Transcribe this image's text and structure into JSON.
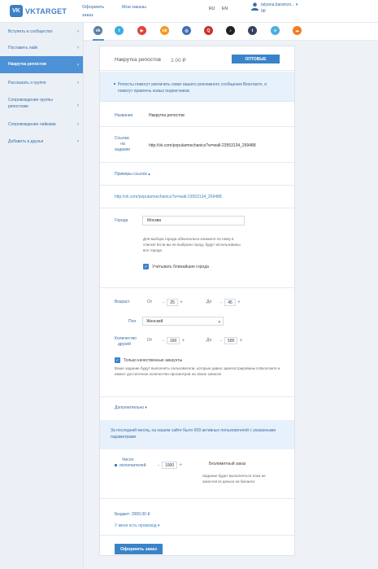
{
  "header": {
    "logo_badge": "VK",
    "logo_text": "VKTARGET",
    "nav": {
      "order_line1": "Оформить",
      "order_line2": "заказ",
      "my_orders": "Мои заказы"
    },
    "lang": {
      "ru": "RU",
      "en": "EN"
    },
    "user": {
      "name": "tatyana.baramzo...",
      "balance": "0₽"
    }
  },
  "sidebar": {
    "items": [
      {
        "label": "Вступить в сообщество"
      },
      {
        "label": "Поставить лайк"
      },
      {
        "label": "Накрутка репостов"
      },
      {
        "label": "Рассказать о группе"
      },
      {
        "label": "Сопровождение группы репостами"
      },
      {
        "label": "Сопровождение лайками"
      },
      {
        "label": "Добавить в друзья"
      }
    ]
  },
  "tabs": [
    {
      "icon": "vk-icon",
      "glyph": "vk",
      "color": "#5b7fa6"
    },
    {
      "icon": "twitter-icon",
      "glyph": "t",
      "color": "#3ab0e2"
    },
    {
      "icon": "youtube-icon",
      "glyph": "▶",
      "color": "#e0443a"
    },
    {
      "icon": "odnoklassniki-icon",
      "glyph": "ok",
      "color": "#f29a23"
    },
    {
      "icon": "instagram-icon",
      "glyph": "◎",
      "color": "#3d6fb4"
    },
    {
      "icon": "quora-icon",
      "glyph": "Q",
      "color": "#c8342e"
    },
    {
      "icon": "tiktok-icon",
      "glyph": "♪",
      "color": "#222222"
    },
    {
      "icon": "tumblr-icon",
      "glyph": "t",
      "color": "#35465c"
    },
    {
      "icon": "vimeo-icon",
      "glyph": "v",
      "color": "#4bb0e0"
    },
    {
      "icon": "soundcloud-icon",
      "glyph": "☁",
      "color": "#f57c1f"
    }
  ],
  "form": {
    "title": "Накрутка репостов",
    "price": "2.00 ₽",
    "wholesale_button": "ОПТОВЫЕ",
    "info": "Репосты помогут увеличить охват вашего рекламного сообщения Вконтакте, и помогут привлечь новых подписчиков.",
    "name_label": "Название",
    "name_value": "Накрутка репостов",
    "link_label_1": "Ссылка",
    "link_label_2": "на",
    "link_label_3": "задание",
    "link_value": "http://vk.com/popularmechanics?w=wall-23553134_269488",
    "examples_label": "Примеры ссылок",
    "example_link": "http://vk.com/popularmechanics?w=wall-23553134_269488",
    "city_label": "Города",
    "city_value": "Москва",
    "city_hint": "Для выбора города обязательно кликните по нему в списке! Если вы не выбрали город, будут использованы все города",
    "nearby_label": "Учитывать ближайшие города",
    "age_label": "Возраст",
    "from_label": "От",
    "to_label": "До",
    "age_from": "25",
    "age_to": "45",
    "gender_label": "Пол",
    "gender_value": "Женский",
    "friends_label_1": "Количество",
    "friends_label_2": "друзей",
    "friends_from": "160",
    "friends_to": "500",
    "quality_label": "Только качественные аккаунты",
    "quality_hint": "Ваше задание будут выполнять пользователи, которые давно зарегистрированы в Вконтакте и имеют достаточное количество просмотров на своих записях",
    "additional_label": "Дополнительно",
    "stats_text": "За последний месяц, на нашем сайте было 609 активных пользователей с указанными параметрами",
    "executors_label_1": "Число",
    "executors_label_2": "исполнителей",
    "executors_value": "1000",
    "unlimited_label": "Безлимитный заказ",
    "unlimited_hint": "Задание будет выполняться пока не закончатся деньги на балансе",
    "budget": "Бюджет: 2000.00 ₽",
    "promo_label": "У меня есть промокод",
    "order_button": "Оформить заказ"
  }
}
